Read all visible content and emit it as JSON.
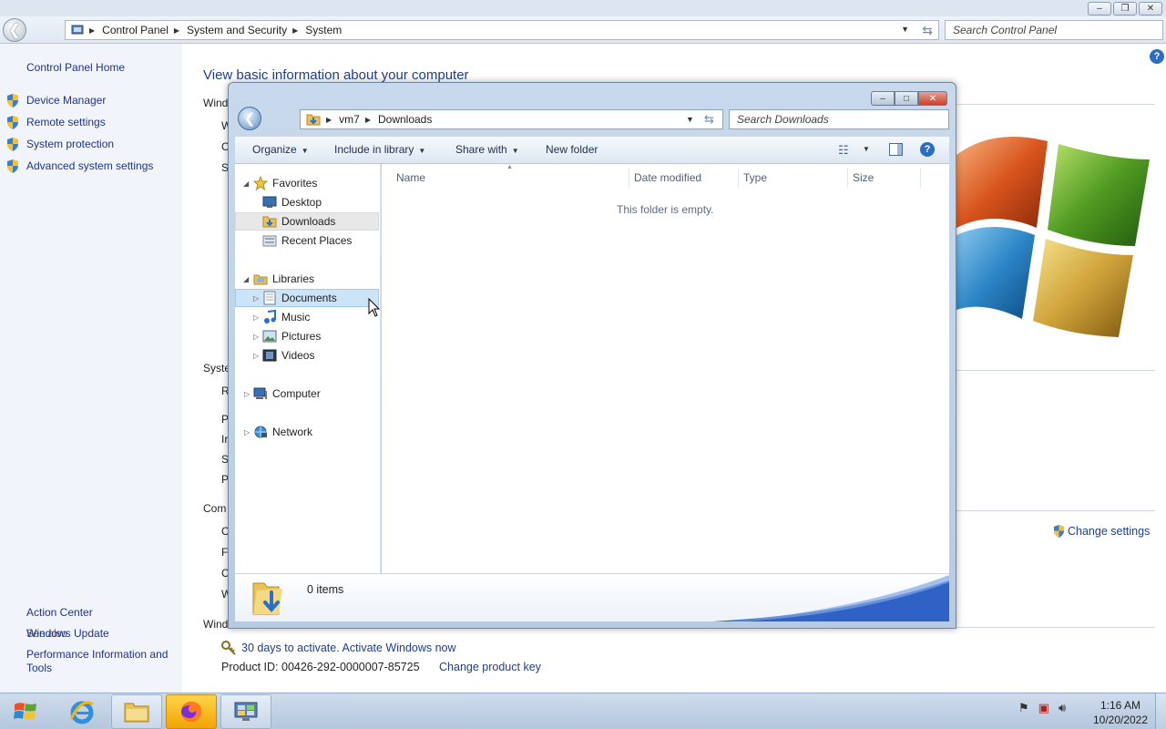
{
  "control_panel": {
    "breadcrumb": [
      "Control Panel",
      "System and Security",
      "System"
    ],
    "search_placeholder": "Search Control Panel",
    "sidebar": {
      "home": "Control Panel Home",
      "links": [
        "Device Manager",
        "Remote settings",
        "System protection",
        "Advanced system settings"
      ],
      "see_also_label": "See also",
      "see_also": [
        "Action Center",
        "Windows Update",
        "Performance Information and",
        "Tools"
      ]
    },
    "title": "View basic information about your computer",
    "fragments": [
      "Wind",
      "W",
      "C",
      "S",
      "Syste",
      "R",
      "P",
      "Ir",
      "S",
      "P",
      "Com",
      "C",
      "F",
      "C",
      "W",
      "Wind"
    ],
    "change_settings": "Change settings",
    "activation": "30 days to activate. Activate Windows now",
    "product_id": "Product ID: 00426-292-0000007-85725",
    "change_product_key": "Change product key"
  },
  "explorer": {
    "breadcrumb": [
      "vm7",
      "Downloads"
    ],
    "search_placeholder": "Search Downloads",
    "toolbar": {
      "organize": "Organize",
      "include_in_library": "Include in library",
      "share_with": "Share with",
      "new_folder": "New folder"
    },
    "nav": {
      "favorites": "Favorites",
      "desktop": "Desktop",
      "downloads": "Downloads",
      "recent_places": "Recent Places",
      "libraries": "Libraries",
      "documents": "Documents",
      "music": "Music",
      "pictures": "Pictures",
      "videos": "Videos",
      "computer": "Computer",
      "network": "Network"
    },
    "columns": [
      "Name",
      "Date modified",
      "Type",
      "Size"
    ],
    "empty_message": "This folder is empty.",
    "status": "0 items"
  },
  "taskbar": {
    "time": "1:16 AM",
    "date": "10/20/2022"
  },
  "colors": {
    "link": "#1e3287",
    "title": "#1e3e87",
    "selection_hover": "#cce4f7",
    "taskbar_active": "#f2a404"
  }
}
